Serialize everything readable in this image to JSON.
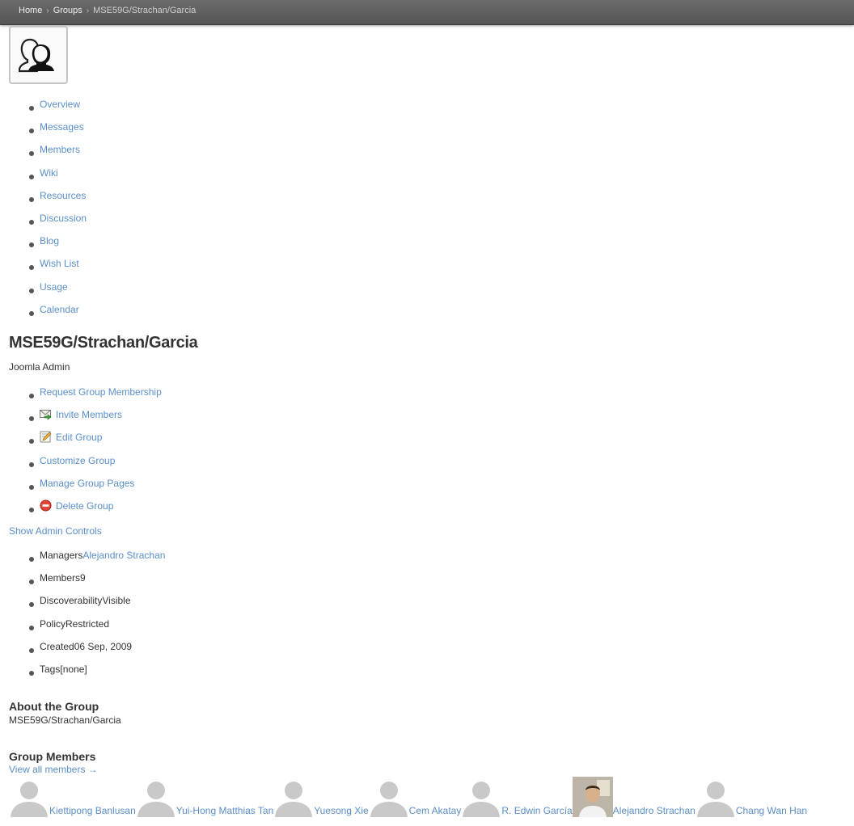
{
  "breadcrumb": [
    "Home",
    "Groups",
    "MSE59G/Strachan/Garcia"
  ],
  "nav": [
    "Overview",
    "Messages",
    "Members",
    "Wiki",
    "Resources",
    "Discussion",
    "Blog",
    "Wish List",
    "Usage",
    "Calendar"
  ],
  "group": {
    "title": "MSE59G/Strachan/Garcia",
    "owner": "Joomla Admin"
  },
  "actions": {
    "request": "Request Group Membership",
    "invite": "Invite Members",
    "edit": "Edit Group",
    "customize": "Customize Group",
    "manage_pages": "Manage Group Pages",
    "delete": "Delete Group"
  },
  "admin_controls": "Show Admin Controls",
  "meta": {
    "managers_label": "Managers",
    "managers_value": "Alejandro Strachan",
    "members_label": "Members",
    "members_value": "9",
    "discoverability_label": "Discoverability",
    "discoverability_value": "Visible",
    "policy_label": "Policy",
    "policy_value": "Restricted",
    "created_label": "Created",
    "created_value": "06 Sep, 2009",
    "tags_label": "Tags",
    "tags_value": "[none]"
  },
  "about": {
    "heading": "About the Group",
    "text": "MSE59G/Strachan/Garcia"
  },
  "members_section": {
    "heading": "Group Members",
    "view_all": "View all members →",
    "list": [
      "Kiettipong Banlusan",
      "Yui-Hong Matthias Tan",
      "Yuesong Xie",
      "Cem Akatay",
      "R. Edwin García",
      "Alejandro Strachan",
      "Chang Wan Han"
    ]
  },
  "colors": {
    "link": "#5a8fc8",
    "topbar": "#5e5e5e",
    "text": "#333333"
  }
}
